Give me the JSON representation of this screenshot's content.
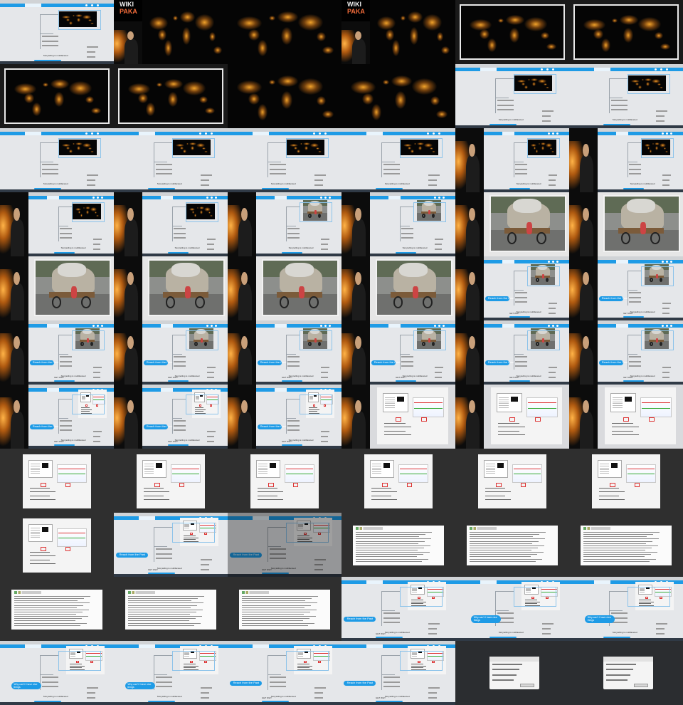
{
  "sheet": {
    "cols": 6,
    "rows": 11,
    "cell_width": 160,
    "cell_height": 90,
    "background": "#1a1a1a"
  },
  "colors": {
    "accent_blue": "#1e9be6",
    "canvas_grey": "#e5e7ea",
    "node_text": "#2b2b2b",
    "map_lights": "#f0a12a",
    "stage_black": "#050505",
    "doc_white": "#f4f4f4",
    "dark_desktop": "#2f2f2f"
  },
  "texts": {
    "story": "Storytelling is multifaceted",
    "past": "Reach from the Past",
    "got_why": "GET WHY",
    "why_long": "Why can't I have nice things",
    "logo_line1": "WIKI",
    "logo_line2": "PAKA",
    "title_bar": "Mindmap presentation"
  },
  "frames": [
    {
      "type": "mindmap_map",
      "variant": "small"
    },
    {
      "type": "logo_stage"
    },
    {
      "type": "map_full",
      "framed": false
    },
    {
      "type": "logo_stage"
    },
    {
      "type": "map_full",
      "framed": true
    },
    {
      "type": "map_full",
      "framed": true
    },
    {
      "type": "map_full",
      "framed": true
    },
    {
      "type": "map_full",
      "framed": true
    },
    {
      "type": "map_full",
      "framed": false
    },
    {
      "type": "map_full",
      "framed": false
    },
    {
      "type": "mindmap_map",
      "variant": "mid"
    },
    {
      "type": "mindmap_map",
      "variant": "mid"
    },
    {
      "type": "mindmap_map",
      "variant": "mid"
    },
    {
      "type": "mindmap_map",
      "variant": "mid"
    },
    {
      "type": "mindmap_map",
      "variant": "mid"
    },
    {
      "type": "mindmap_map",
      "variant": "mid"
    },
    {
      "type": "speaker_mindmap",
      "content": "map"
    },
    {
      "type": "speaker_mindmap",
      "content": "map"
    },
    {
      "type": "speaker_mindmap",
      "content": "map"
    },
    {
      "type": "speaker_mindmap",
      "content": "map"
    },
    {
      "type": "speaker_mindmap",
      "content": "cart_small"
    },
    {
      "type": "speaker_mindmap",
      "content": "cart_small"
    },
    {
      "type": "speaker_photo"
    },
    {
      "type": "speaker_photo"
    },
    {
      "type": "speaker_photo"
    },
    {
      "type": "speaker_photo"
    },
    {
      "type": "speaker_photo"
    },
    {
      "type": "speaker_photo"
    },
    {
      "type": "speaker_mindmap",
      "content": "cart_past"
    },
    {
      "type": "speaker_mindmap",
      "content": "cart_past"
    },
    {
      "type": "speaker_mindmap",
      "content": "cart_past"
    },
    {
      "type": "speaker_mindmap",
      "content": "cart_past"
    },
    {
      "type": "speaker_mindmap",
      "content": "cart_past"
    },
    {
      "type": "speaker_mindmap",
      "content": "cart_past"
    },
    {
      "type": "speaker_mindmap",
      "content": "cart_past"
    },
    {
      "type": "speaker_mindmap",
      "content": "cart_past"
    },
    {
      "type": "speaker_mindmap",
      "content": "doc_past"
    },
    {
      "type": "speaker_mindmap",
      "content": "doc_past"
    },
    {
      "type": "speaker_mindmap",
      "content": "doc_past"
    },
    {
      "type": "speaker_doc"
    },
    {
      "type": "speaker_doc"
    },
    {
      "type": "speaker_doc"
    },
    {
      "type": "dark_doc"
    },
    {
      "type": "dark_doc"
    },
    {
      "type": "dark_doc"
    },
    {
      "type": "dark_doc"
    },
    {
      "type": "dark_doc"
    },
    {
      "type": "dark_doc"
    },
    {
      "type": "dark_doc"
    },
    {
      "type": "mindmap_doc_past"
    },
    {
      "type": "mindmap_doc_past",
      "dim": true
    },
    {
      "type": "dark_text"
    },
    {
      "type": "dark_text"
    },
    {
      "type": "dark_text"
    },
    {
      "type": "dark_text"
    },
    {
      "type": "dark_text"
    },
    {
      "type": "dark_text"
    },
    {
      "type": "mindmap_doc_past"
    },
    {
      "type": "mindmap_whycant"
    },
    {
      "type": "mindmap_whycant"
    },
    {
      "type": "mindmap_whycant",
      "left": true
    },
    {
      "type": "mindmap_whycant",
      "left": true
    },
    {
      "type": "mindmap_past_doc2"
    },
    {
      "type": "mindmap_past_doc2"
    },
    {
      "type": "dark_dialog"
    },
    {
      "type": "dark_dialog"
    }
  ]
}
